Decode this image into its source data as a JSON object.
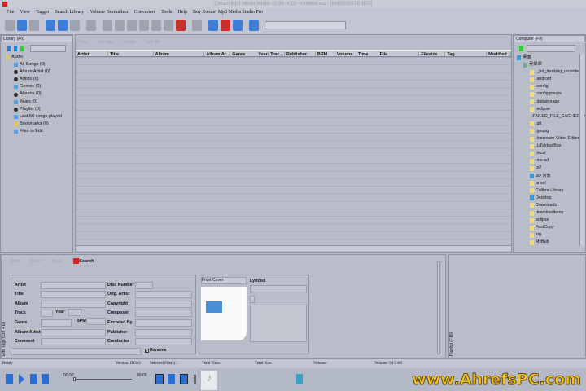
{
  "app": {
    "title": "Zortam Mp3 Media Studio 22.95 (x32) - Untitled.xsz - [UNREGISTERED]"
  },
  "menu": [
    "File",
    "View",
    "Tagger",
    "Search Library",
    "Volume Normalizer",
    "Converters",
    "Tools",
    "Help",
    "Buy Zortam Mp3 Media Studio Pro"
  ],
  "toolbar": {
    "icons": [
      "new-file-icon",
      "open-folder-icon",
      "save-icon",
      "search-icon",
      "zoom-icon",
      "magnifier-icon",
      "auto-tag-icon",
      "tag-icon",
      "edit-icon",
      "edit-multi-icon",
      "youtube-icon",
      "file-icon",
      "ringtone-icon",
      "mp3-icon",
      "wrench-icon",
      "cd-icon",
      "youtube-mp3-icon",
      "music-note-icon",
      "settings-icon"
    ]
  },
  "library": {
    "header": "Library (F6)",
    "tree": [
      {
        "label": "Audio",
        "icon": "folder",
        "level": 0
      },
      {
        "label": "All Songs (0)",
        "icon": "music",
        "level": 1
      },
      {
        "label": "Album Artist (0)",
        "icon": "disc",
        "level": 1
      },
      {
        "label": "Artists (0)",
        "icon": "person",
        "level": 1
      },
      {
        "label": "Genres (0)",
        "icon": "note",
        "level": 1
      },
      {
        "label": "Albums (0)",
        "icon": "disc",
        "level": 1
      },
      {
        "label": "Years (0)",
        "icon": "calendar",
        "level": 1
      },
      {
        "label": "Playlist (0)",
        "icon": "list",
        "level": 1
      },
      {
        "label": "Last 50 songs played",
        "icon": "music",
        "level": 1
      },
      {
        "label": "Bookmarks (0)",
        "icon": "folder",
        "level": 1
      },
      {
        "label": "Files to Edit",
        "icon": "music",
        "level": 1
      }
    ]
  },
  "grid": {
    "tools": [
      "Play",
      "File Info",
      "Delete",
      "Sel. All"
    ],
    "columns": [
      {
        "label": "Artist",
        "w": 40
      },
      {
        "label": "Title",
        "w": 56
      },
      {
        "label": "Album",
        "w": 63
      },
      {
        "label": "Album Ar...",
        "w": 32
      },
      {
        "label": "Genre",
        "w": 32
      },
      {
        "label": "Year",
        "w": 15
      },
      {
        "label": "Trac...",
        "w": 20
      },
      {
        "label": "Publisher",
        "w": 38
      },
      {
        "label": "BPM",
        "w": 24
      },
      {
        "label": "Volume",
        "w": 26
      },
      {
        "label": "Time",
        "w": 27
      },
      {
        "label": "File",
        "w": 51
      },
      {
        "label": "Filesize",
        "w": 32
      },
      {
        "label": "Tag",
        "w": 51
      },
      {
        "label": "Modified",
        "w": 30
      }
    ]
  },
  "computer": {
    "header": "Computer (F9)",
    "tree": [
      {
        "label": "桌面",
        "icon": "blue",
        "level": 0
      },
      {
        "label": "吴翠翠",
        "icon": "person",
        "level": 1
      },
      {
        "label": "._hrt_tracking_recorder",
        "icon": "folder",
        "level": 2
      },
      {
        "label": ".android",
        "icon": "folder",
        "level": 2
      },
      {
        "label": ".config",
        "icon": "folder",
        "level": 2
      },
      {
        "label": ".configgroups",
        "icon": "folder",
        "level": 2
      },
      {
        "label": ".datastorage",
        "icon": "folder",
        "level": 2
      },
      {
        "label": ".eclipse",
        "icon": "folder",
        "level": 2
      },
      {
        "label": ".FAILED_FILE_CACHED_DI",
        "icon": "folder",
        "level": 2
      },
      {
        "label": ".git",
        "icon": "folder",
        "level": 2
      },
      {
        "label": ".gnupg",
        "icon": "folder",
        "level": 2
      },
      {
        "label": ".Icecream Video Editor",
        "icon": "folder",
        "level": 2
      },
      {
        "label": ".LdVirtualBox",
        "icon": "folder",
        "level": 2
      },
      {
        "label": ".local",
        "icon": "folder",
        "level": 2
      },
      {
        "label": ".ms-ad",
        "icon": "folder",
        "level": 2
      },
      {
        "label": ".p2",
        "icon": "folder",
        "level": 2
      },
      {
        "label": "3D 对象",
        "icon": "blue",
        "level": 2
      },
      {
        "label": "ansel",
        "icon": "folder",
        "level": 2
      },
      {
        "label": "Calibre Library",
        "icon": "folder",
        "level": 2
      },
      {
        "label": "Desktop",
        "icon": "blue",
        "level": 2
      },
      {
        "label": "Downloads",
        "icon": "folder",
        "level": 2
      },
      {
        "label": "downloadtemp",
        "icon": "folder",
        "level": 2
      },
      {
        "label": "eclipse",
        "icon": "folder",
        "level": 2
      },
      {
        "label": "FastCopy",
        "icon": "folder",
        "level": 2
      },
      {
        "label": "log",
        "icon": "folder",
        "level": 2
      },
      {
        "label": "MyBub",
        "icon": "folder",
        "level": 2
      }
    ]
  },
  "edit": {
    "side_label": "Edit Tags (Ctrl + E)",
    "tools": {
      "next": "Next",
      "prev": "Prev",
      "save": "Save",
      "search": "Search"
    },
    "left_labels": [
      "Artist",
      "Title",
      "Album",
      "Track",
      "Genre",
      "Album Artist",
      "Comment"
    ],
    "year": "Year",
    "bpm": "BPM",
    "mid_labels": [
      "Disc Number",
      "Orig. Artist",
      "Copyright",
      "Composer",
      "Encoded By",
      "Publisher",
      "Conductor"
    ],
    "cover_select": "Front Cover",
    "lyricist": "Lyricist",
    "rename": "Rename",
    "rename_checked": true
  },
  "playlist": {
    "side_label": "Playlist (F10)"
  },
  "status": {
    "ready": "Ready",
    "version": "Version: ID3v2",
    "selected": "Selected File(s) :",
    "total_time": "Total Time:",
    "total_size": "Total Size:",
    "volume": "Volume:",
    "volume_db": "Volume: 94.5 dB"
  },
  "player": {
    "time_start": "00:00",
    "time_end": "00:00",
    "progress": 0
  },
  "watermark": "www.AhrefsPC.com"
}
